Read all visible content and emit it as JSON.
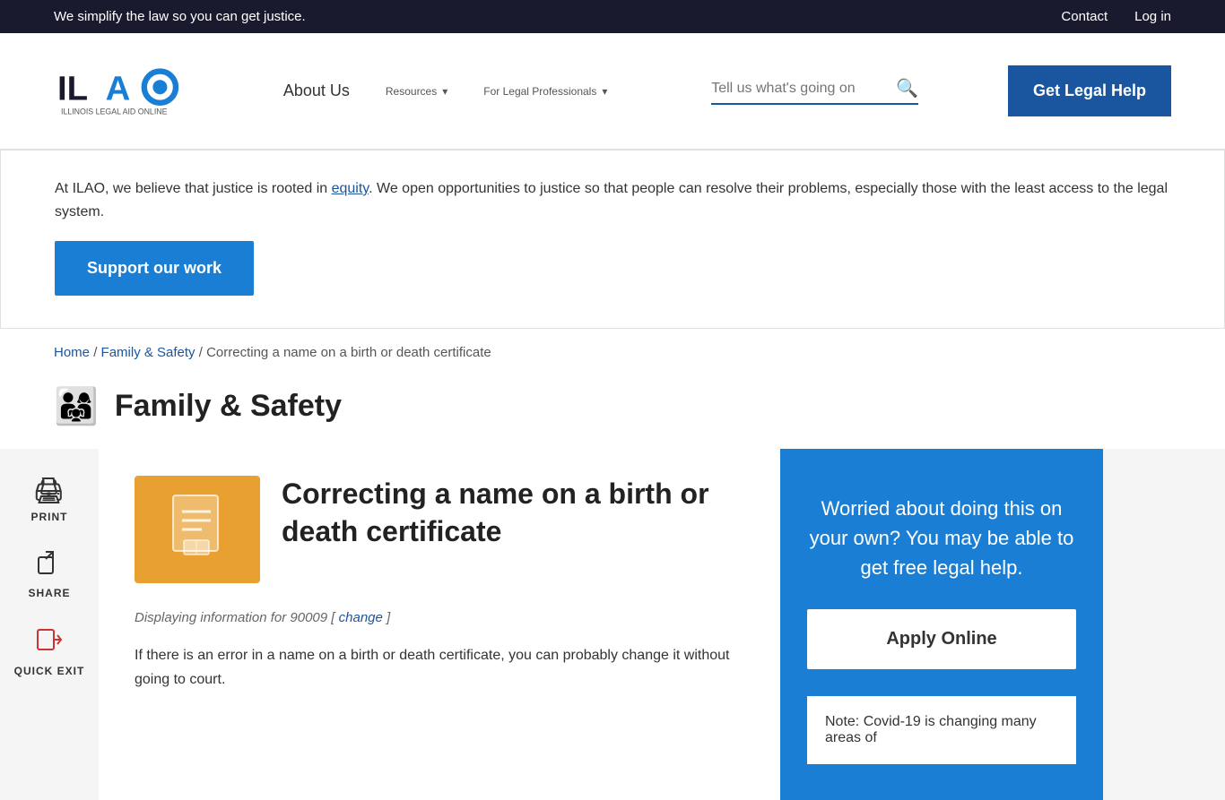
{
  "topbar": {
    "tagline": "We simplify the law so you can get justice.",
    "contact_label": "Contact",
    "login_label": "Log in"
  },
  "nav": {
    "logo_alt": "ILAO Illinois Legal Aid Online",
    "links": [
      {
        "label": "About Us",
        "dropdown": false
      },
      {
        "label": "Resources",
        "dropdown": true
      },
      {
        "label": "For Legal Professionals",
        "dropdown": true
      }
    ],
    "search_placeholder": "Tell us what's going on",
    "get_help_label": "Get Legal Help"
  },
  "mission": {
    "text_before": "At ILAO, we believe that justice is rooted in ",
    "equity_link": "equity",
    "text_after": ". We open opportunities to justice so that people can resolve their problems, especially those with the least access to the legal system.",
    "support_button": "Support our work"
  },
  "breadcrumb": {
    "home": "Home",
    "category": "Family & Safety",
    "current": "Correcting a name on a birth or death certificate"
  },
  "category": {
    "title": "Family & Safety"
  },
  "sidebar_actions": [
    {
      "label": "PRINT",
      "icon": "🖨"
    },
    {
      "label": "SHARE",
      "icon": "↗"
    },
    {
      "label": "QUICK EXIT",
      "icon": "🚪"
    }
  ],
  "article": {
    "title": "Correcting a name on a birth or death certificate",
    "location_text": "Displaying information for 90009 [",
    "location_link": "change",
    "location_text_after": "]",
    "body": "If there is an error in a name on a birth or death certificate, you can probably change it without going to court."
  },
  "right_panel": {
    "help_text": "Worried about doing this on your own? You may be able to get free legal help.",
    "apply_button": "Apply Online"
  },
  "note_box": {
    "text": "Note: Covid-19 is changing many areas of"
  }
}
